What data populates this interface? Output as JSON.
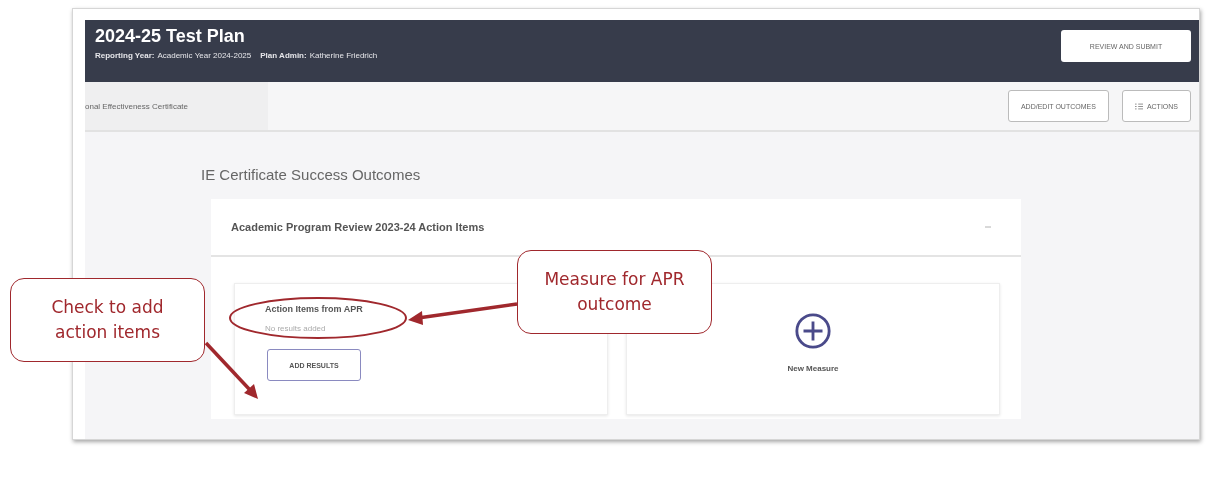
{
  "header": {
    "title": "2024-25 Test Plan",
    "meta": [
      {
        "label": "Reporting Year:",
        "value": "Academic Year 2024-2025"
      },
      {
        "label": "Plan Admin:",
        "value": "Katherine Friedrich"
      }
    ],
    "submit_button": "REVIEW AND SUBMIT"
  },
  "subbar": {
    "tab": "onal Effectiveness Certificate",
    "buttons": [
      {
        "label": "ADD/EDIT OUTCOMES",
        "kind": "plain"
      },
      {
        "label": "ACTIONS",
        "kind": "list"
      }
    ]
  },
  "section_title": "IE Certificate Success Outcomes",
  "panel": {
    "title": "Academic Program Review 2023-24 Action Items",
    "expanded": true,
    "measures": [
      {
        "title": "Action Items from APR",
        "status": "No results added",
        "button": "ADD RESULTS"
      }
    ],
    "new_measure": "New Measure"
  },
  "callouts": [
    {
      "text": "Check to add action items"
    },
    {
      "text": "Measure for APR outcome"
    }
  ]
}
